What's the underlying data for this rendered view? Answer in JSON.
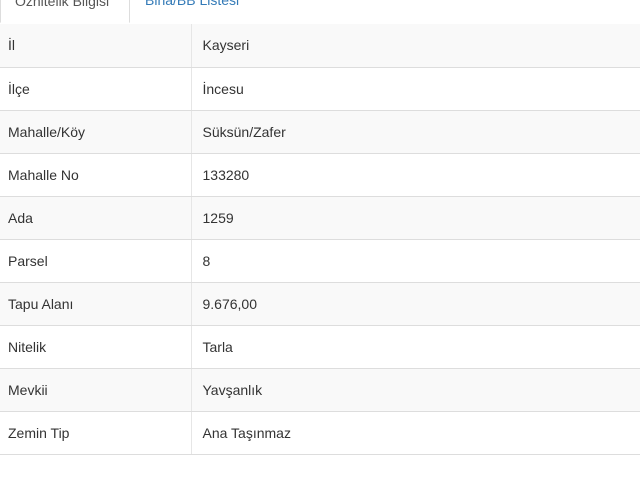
{
  "tabs": [
    {
      "label": "Öznitelik Bilgisi",
      "active": true
    },
    {
      "label": "Bina/BB Listesi",
      "active": false
    }
  ],
  "rows": [
    {
      "key": "İl",
      "value": "Kayseri"
    },
    {
      "key": "İlçe",
      "value": "İncesu"
    },
    {
      "key": "Mahalle/Köy",
      "value": "Süksün/Zafer"
    },
    {
      "key": "Mahalle No",
      "value": "133280"
    },
    {
      "key": "Ada",
      "value": "1259"
    },
    {
      "key": "Parsel",
      "value": "8"
    },
    {
      "key": "Tapu Alanı",
      "value": "9.676,00"
    },
    {
      "key": "Nitelik",
      "value": "Tarla"
    },
    {
      "key": "Mevkii",
      "value": "Yavşanlık"
    },
    {
      "key": "Zemin Tip",
      "value": "Ana Taşınmaz"
    }
  ],
  "colors": {
    "link": "#337ab7",
    "stripe": "#f9f9f9",
    "border": "#dddddd"
  }
}
